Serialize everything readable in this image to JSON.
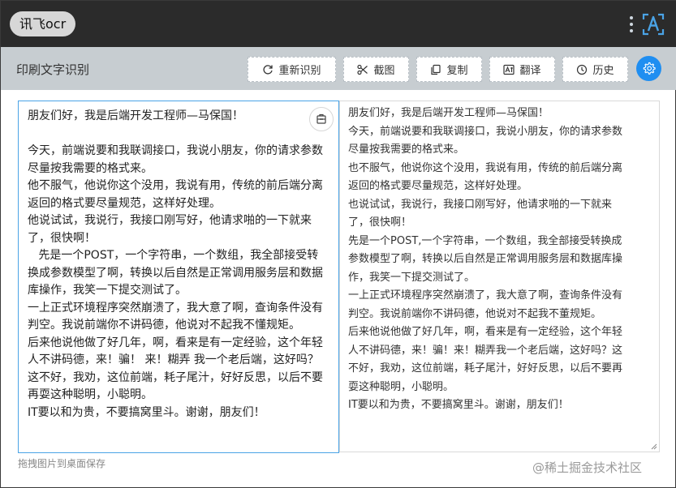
{
  "app": {
    "title": "讯飞ocr"
  },
  "toolbar": {
    "page_title": "印刷文字识别",
    "buttons": {
      "rerecognize": "重新识别",
      "screenshot": "截图",
      "copy": "复制",
      "translate": "翻译",
      "history": "历史"
    }
  },
  "editor": {
    "left_text": "朋友们好，我是后端开发工程师—马保国！\n\n今天，前端说要和我联调接口，我说小朋友，你的请求参数尽量按我需要的格式来。\n他不服气，他说你这个没用，我说有用，传统的前后端分离返回的格式要尽量规范，这样好处理。\n他说试试，我说行，我接口刚写好，他请求啪的一下就来了，很快啊！\n   先是一个POST，一个字符串，一个数组，我全部接受转换成参数模型了啊，转换以后自然是正常调用服务层和数据库操作，我笑一下提交测试了。\n一上正式环境程序突然崩溃了，我大意了啊，查询条件没有判空。我说前端你不讲码德，他说对不起我不懂规矩。\n后来他说他做了好几年，啊，看来是有一定经验，这个年轻人不讲码德，来！骗！ 来！糊弄 我一个老后端，这好吗？这不好，我劝，这位前端，耗子尾汁，好好反思，以后不要再耍这种聪明，小聪明。\nIT要以和为贵，不要搞窝里斗。谢谢，朋友们！",
    "right_text": "朋友们好，我是后端开发工程师—马保国！\n今天，前端说要和我联调接口，我说小朋友，你的请求参数尽量按我需要的格式来。\n也不服气，他说你这个没用，我说有用，传统的前后端分离返回的格式要尽量规范，这样好处理。\n也说试试，我说行，我接口刚写好，他请求啪的一下就来了，很快啊！\n先是一个POST,一个字符串，一个数组，我全部接受转换成参数模型了啊，转换以后自然是正常调用服务层和数据库操作，我笑一下提交测试了。\n一上正式环境程序突然崩溃了，我大意了啊，查询条件没有判空。我说前端你不讲码德，他说对不起我不董规矩。\n后来他说他做了好几年，啊，看来是有一定经验，这个年轻人不讲码德，来！骗！来！糊弄我一个老后端，这好吗？这不好，我劝，这位前端，耗子尾汁，好好反思，以后不要再耍这种聪明，小聪明。\nIT要以和为贵，不要搞窝里斗。谢谢，朋友们！"
  },
  "footer": {
    "hint": "拖拽图片到桌面保存",
    "watermark": "@稀土掘金技术社区"
  },
  "colors": {
    "titlebar": "#2b2b2b",
    "toolbar": "#c7cdd1",
    "accent": "#1f8ef1",
    "logo": "#4aa3e6"
  },
  "icons": {
    "rerecognize": "refresh-icon",
    "screenshot": "scissors-icon",
    "copy": "copy-icon",
    "translate": "translate-icon",
    "history": "clock-icon",
    "settings": "gear-icon",
    "logo": "font-a-icon",
    "menu": "kebab-menu-icon"
  }
}
